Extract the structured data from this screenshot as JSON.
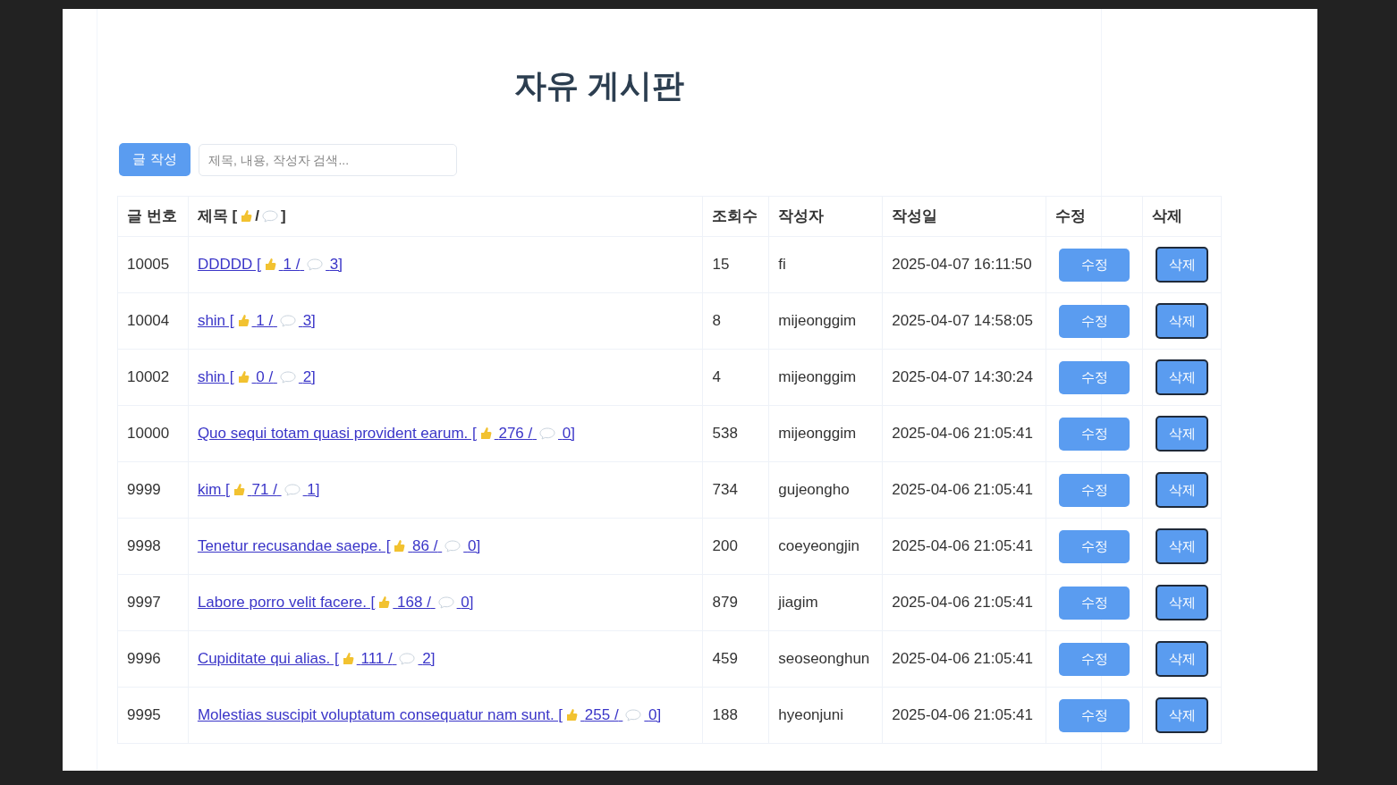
{
  "heading": "자유 게시판",
  "write_button": "글 작성",
  "search": {
    "placeholder": "제목, 내용, 작성자 검색..."
  },
  "table": {
    "columns": [
      "글 번호",
      "조회수",
      "작성자",
      "작성일",
      "수정",
      "삭제"
    ],
    "title_header": {
      "start": "제목 [",
      "middle": "/",
      "end": "]"
    },
    "rows": [
      {
        "no": "10005",
        "title_parts": [
          "DDDDD [",
          "1 /",
          "3]"
        ],
        "views": "15",
        "author": "fi",
        "date": "2025-04-07 16:11:50",
        "edit": "수정",
        "delete": "삭제"
      },
      {
        "no": "10004",
        "title_parts": [
          "shin [",
          "1 /",
          "3]"
        ],
        "views": "8",
        "author": "mijeonggim",
        "date": "2025-04-07 14:58:05",
        "edit": "수정",
        "delete": "삭제"
      },
      {
        "no": "10002",
        "title_parts": [
          "shin [",
          "0 /",
          "2]"
        ],
        "views": "4",
        "author": "mijeonggim",
        "date": "2025-04-07 14:30:24",
        "edit": "수정",
        "delete": "삭제"
      },
      {
        "no": "10000",
        "title_parts": [
          "Quo sequi totam quasi provident earum. [",
          "276 /",
          "0]"
        ],
        "views": "538",
        "author": "mijeonggim",
        "date": "2025-04-06 21:05:41",
        "edit": "수정",
        "delete": "삭제"
      },
      {
        "no": "9999",
        "title_parts": [
          "kim [",
          "71 /",
          "1]"
        ],
        "views": "734",
        "author": "gujeongho",
        "date": "2025-04-06 21:05:41",
        "edit": "수정",
        "delete": "삭제"
      },
      {
        "no": "9998",
        "title_parts": [
          "Tenetur recusandae saepe. [",
          "86 /",
          "0]"
        ],
        "views": "200",
        "author": "coeyeongjin",
        "date": "2025-04-06 21:05:41",
        "edit": "수정",
        "delete": "삭제"
      },
      {
        "no": "9997",
        "title_parts": [
          "Labore porro velit facere. [",
          "168 /",
          "0]"
        ],
        "views": "879",
        "author": "jiagim",
        "date": "2025-04-06 21:05:41",
        "edit": "수정",
        "delete": "삭제"
      },
      {
        "no": "9996",
        "title_parts": [
          "Cupiditate qui alias. [",
          "111 /",
          "2]"
        ],
        "views": "459",
        "author": "seoseonghun",
        "date": "2025-04-06 21:05:41",
        "edit": "수정",
        "delete": "삭제"
      },
      {
        "no": "9995",
        "title_parts": [
          "Molestias suscipit voluptatum consequatur nam sunt. [",
          "255 /",
          "0]"
        ],
        "views": "188",
        "author": "hyeonjuni",
        "date": "2025-04-06 21:05:41",
        "edit": "수정",
        "delete": "삭제"
      }
    ]
  }
}
